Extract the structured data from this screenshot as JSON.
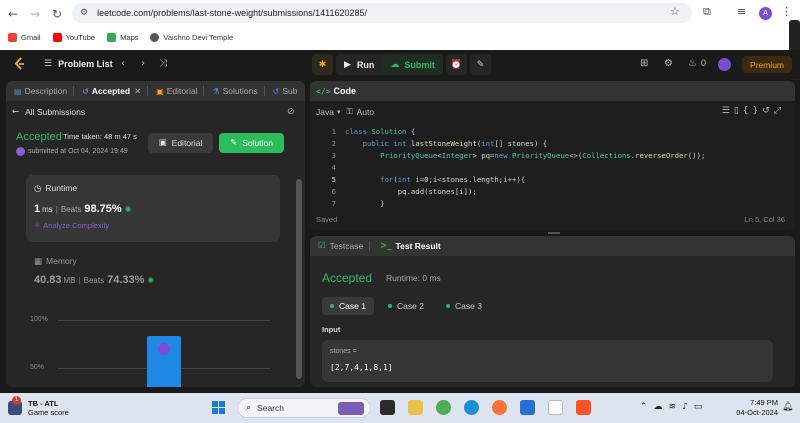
{
  "browser": {
    "url": "leetcode.com/problems/last-stone-weight/submissions/1411620285/",
    "profile_initial": "A",
    "bookmarks": [
      {
        "label": "Gmail",
        "color": "#ea4335"
      },
      {
        "label": "YouTube",
        "color": "#ff0000"
      },
      {
        "label": "Maps",
        "color": "#34a853"
      },
      {
        "label": "Vaishno Devi Temple",
        "color": "#555555"
      }
    ]
  },
  "header": {
    "problem_list": "Problem List",
    "run": "Run",
    "submit": "Submit",
    "streak": "0",
    "premium": "Premium"
  },
  "left_tabs": [
    {
      "label": "Description"
    },
    {
      "label": "Accepted"
    },
    {
      "label": "Editorial"
    },
    {
      "label": "Solutions"
    },
    {
      "label": "Sub"
    }
  ],
  "submission": {
    "back_label": "All Submissions",
    "status": "Accepted",
    "time_taken": "Time taken: 48 m 47 s",
    "submitted_at": "submitted at Oct 04, 2024 19:49",
    "editorial_btn": "Editorial",
    "solution_btn": "Solution",
    "runtime": {
      "heading": "Runtime",
      "value": "1",
      "unit": "ms",
      "beats_label": "Beats",
      "beats": "98.75%",
      "analyze": "Analyze Complexity"
    },
    "memory": {
      "heading": "Memory",
      "value": "40.83",
      "unit": "MB",
      "beats_label": "Beats",
      "beats": "74.33%"
    },
    "chart_ticks": [
      "100%",
      "50%"
    ]
  },
  "code": {
    "title": "Code",
    "language": "Java",
    "autosave": "Auto",
    "status": "Saved",
    "cursor": "Ln 5, Col 36",
    "lines": [
      {
        "n": "1",
        "text": "class Solution {"
      },
      {
        "n": "2",
        "text": "    public int lastStoneWeight(int[] stones) {"
      },
      {
        "n": "3",
        "text": "        PriorityQueue<Integer> pq=new PriorityQueue<>(Collections.reverseOrder());"
      },
      {
        "n": "4",
        "text": ""
      },
      {
        "n": "5",
        "text": "        for(int i=0;i<stones.length;i++){"
      },
      {
        "n": "6",
        "text": "            pq.add(stones[i]);"
      },
      {
        "n": "7",
        "text": "        }"
      }
    ]
  },
  "test": {
    "tab_testcase": "Testcase",
    "tab_result": "Test Result",
    "status": "Accepted",
    "runtime": "Runtime: 0 ms",
    "cases": [
      "Case 1",
      "Case 2",
      "Case 3"
    ],
    "input_label": "Input",
    "param_name": "stones =",
    "param_value": "[2,7,4,1,8,1]"
  },
  "taskbar": {
    "weather_title": "TB - ATL",
    "weather_sub": "Game score",
    "notification_count": "1",
    "search": "Search",
    "time": "7:49 PM",
    "date": "04-Oct-2024"
  }
}
